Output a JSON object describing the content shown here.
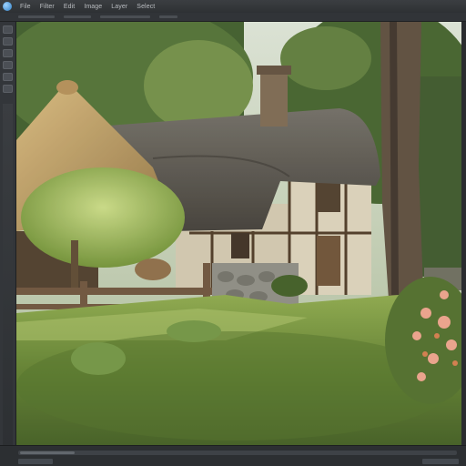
{
  "app": {
    "icon": "app-logo-icon",
    "menu": [
      "File",
      "Filter",
      "Edit",
      "Image",
      "Layer",
      "Select"
    ]
  },
  "canvas": {
    "subject": "",
    "image_name": "cottage-image"
  },
  "colors": {
    "chrome": "#2b2d30",
    "menubar": "#33363a",
    "accent": "#2f7fc4"
  }
}
